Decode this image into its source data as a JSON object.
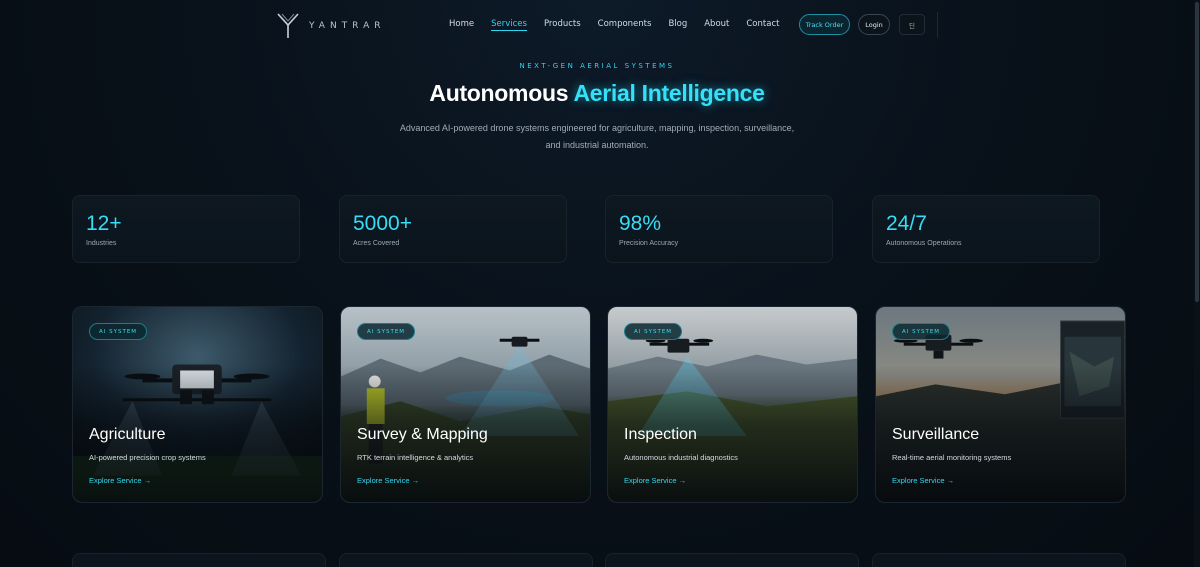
{
  "nav": {
    "brand": "YANTRAR",
    "links": [
      "Home",
      "Services",
      "Products",
      "Components",
      "Blog",
      "About",
      "Contact"
    ],
    "active_link": "Services",
    "track_order": "Track Order",
    "login": "Login",
    "language": "딘"
  },
  "hero": {
    "eyebrow": "NEXT-GEN AERIAL SYSTEMS",
    "title_white": "Autonomous",
    "title_cyan": "Aerial Intelligence",
    "subtitle_line1": "Advanced AI-powered drone systems engineered for agriculture, mapping, inspection, surveillance,",
    "subtitle_line2": "and industrial automation."
  },
  "stats": [
    {
      "value": "12+",
      "label": "Industries"
    },
    {
      "value": "5000+",
      "label": "Acres Covered"
    },
    {
      "value": "98%",
      "label": "Precision Accuracy"
    },
    {
      "value": "24/7",
      "label": "Autonomous Operations"
    }
  ],
  "services": [
    {
      "badge": "AI SYSTEM",
      "title": "Agriculture",
      "description": "AI-powered precision crop systems",
      "link": "Explore Service →",
      "image_icon": "crop-spraying-drone-icon"
    },
    {
      "badge": "AI SYSTEM",
      "title": "Survey & Mapping",
      "description": "RTK terrain intelligence & analytics",
      "link": "Explore Service →",
      "image_icon": "survey-drone-icon"
    },
    {
      "badge": "AI SYSTEM",
      "title": "Inspection",
      "description": "Autonomous industrial diagnostics",
      "link": "Explore Service →",
      "image_icon": "inspection-drone-icon"
    },
    {
      "badge": "AI SYSTEM",
      "title": "Surveillance",
      "description": "Real-time aerial monitoring systems",
      "link": "Explore Service →",
      "image_icon": "surveillance-drone-icon"
    }
  ],
  "colors": {
    "accent": "#2ad6f0",
    "background": "#081018",
    "card_border": "#18222b"
  }
}
